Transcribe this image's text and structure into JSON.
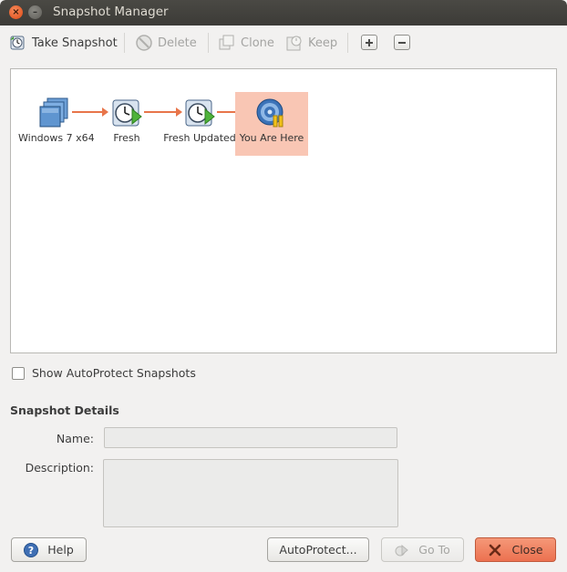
{
  "window": {
    "title": "Snapshot Manager",
    "close_glyph": "×",
    "min_glyph": "–"
  },
  "toolbar": {
    "take_snapshot": "Take Snapshot",
    "delete": "Delete",
    "clone": "Clone",
    "keep": "Keep"
  },
  "snapshots": [
    {
      "label": "Windows 7 x64",
      "icon": "vm-stack-icon"
    },
    {
      "label": "Fresh",
      "icon": "snapshot-clock-icon"
    },
    {
      "label": "Fresh Updated",
      "icon": "snapshot-clock-icon"
    },
    {
      "label": "You Are Here",
      "icon": "you-are-here-icon",
      "current": true
    }
  ],
  "autoprotect": {
    "label": "Show AutoProtect Snapshots",
    "checked": false
  },
  "details": {
    "heading": "Snapshot Details",
    "name_label": "Name:",
    "name_value": "",
    "description_label": "Description:",
    "description_value": ""
  },
  "buttons": {
    "help": "Help",
    "autoprotect": "AutoProtect...",
    "goto": "Go To",
    "close": "Close"
  },
  "colors": {
    "accent": "#ec7150",
    "arrow": "#e8754a",
    "current_highlight": "#f9c6b4",
    "titlebar": "#3c3b37"
  }
}
